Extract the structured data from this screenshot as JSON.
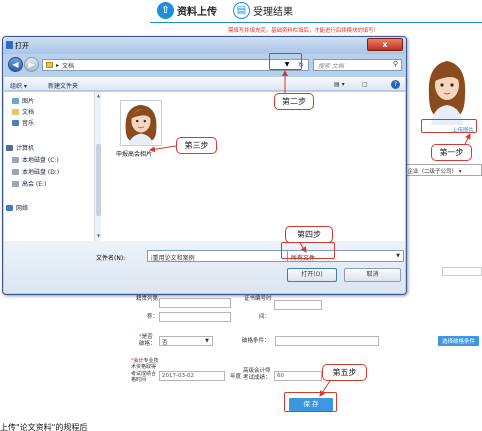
{
  "page": {
    "tabs": [
      {
        "icon": "upload-icon",
        "label": "资料上传"
      },
      {
        "icon": "result-icon",
        "label": "受理结果"
      }
    ],
    "notice": "需填写并填充完，基础资料栏填后，才能进行后续模块的填写！",
    "upload_link": "上传图片",
    "org_select_value": "国企业（二级子公司）",
    "form": {
      "row1": {
        "left_label": "籍贯列第",
        "right_label": "证书编号时"
      },
      "row2": {
        "left_label": "称：",
        "right_label": "间："
      },
      "row3": {
        "left_label": "是否破格：",
        "select_value": "否",
        "right_label": "破格条件：",
        "button": "选择破格条件"
      },
      "row4": {
        "left_label": "会计专业技术资格取得考试成绩合格时间",
        "date_value": "2017-03-02",
        "mid_label": "年度",
        "score_label": "高级会计师考试成绩：",
        "score_value": "60"
      },
      "save_button": "保 存"
    },
    "bottom_text": "上传\"论文资料\"的规程后"
  },
  "dialog": {
    "title": "打开",
    "close_label": "x",
    "address": [
      "▸",
      "文档"
    ],
    "search_placeholder": "搜索 文档",
    "toolbar": {
      "organize": "组织 ▾",
      "new_folder": "新建文件夹"
    },
    "sidebar": [
      {
        "label": "图片",
        "icon": "pictures-icon",
        "color": "#6aa4d8"
      },
      {
        "label": "文档",
        "icon": "documents-icon",
        "color": "#e2c46b"
      },
      {
        "label": "音乐",
        "icon": "music-icon",
        "color": "#4f7fbf"
      },
      {
        "label": "计算机",
        "icon": "computer-icon",
        "color": "#4a6fa5"
      },
      {
        "label": "本地磁盘 (C:)",
        "icon": "drive-c-icon",
        "color": "#9aa6b5"
      },
      {
        "label": "本地磁盘 (D:)",
        "icon": "drive-d-icon",
        "color": "#9aa6b5"
      },
      {
        "label": "高会 (E:)",
        "icon": "drive-e-icon",
        "color": "#9aa6b5"
      },
      {
        "label": "网络",
        "icon": "network-icon",
        "color": "#3f7cc4"
      }
    ],
    "file": {
      "name": "申报高会相片"
    },
    "filename_label": "文件名(N):",
    "filename_value": "i重用论文和案例",
    "filetype_value": "所有文件",
    "open_button": "打开(O)",
    "cancel_button": "取消"
  },
  "annotations": {
    "step1": "第一步",
    "step2": "第二步",
    "step3": "第三步",
    "step4": "第四步",
    "step5": "第五步",
    "accent_color": "#d43a2f"
  }
}
